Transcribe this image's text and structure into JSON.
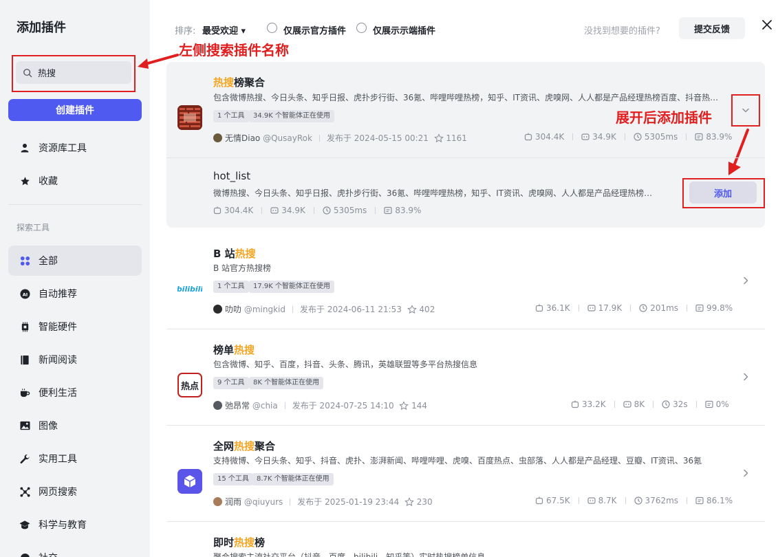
{
  "sidebar": {
    "title": "添加插件",
    "search_value": "热搜",
    "create_label": "创建插件",
    "top_items": [
      {
        "label": "资源库工具",
        "icon": "person-icon"
      },
      {
        "label": "收藏",
        "icon": "star-icon"
      }
    ],
    "section_label": "探索工具",
    "items": [
      {
        "label": "全部",
        "icon": "grid-icon"
      },
      {
        "label": "自动推荐",
        "icon": "ai-icon"
      },
      {
        "label": "智能硬件",
        "icon": "chip-icon"
      },
      {
        "label": "新闻阅读",
        "icon": "book-icon"
      },
      {
        "label": "便利生活",
        "icon": "cup-icon"
      },
      {
        "label": "图像",
        "icon": "image-icon"
      },
      {
        "label": "实用工具",
        "icon": "wrench-icon"
      },
      {
        "label": "网页搜索",
        "icon": "network-icon"
      },
      {
        "label": "科学与教育",
        "icon": "graduation-icon"
      },
      {
        "label": "社交",
        "icon": "chat-icon"
      }
    ]
  },
  "topbar": {
    "sort_label": "排序:",
    "sort_value": "最受欢迎 ▾",
    "official_only": "仅展示官方插件",
    "client_only": "仅展示示端插件",
    "hint": "没找到想要的插件?",
    "feedback": "提交反馈"
  },
  "annotations": {
    "search": "左侧搜索插件名称",
    "add": "展开后添加插件"
  },
  "plugins": [
    {
      "title_pre": "",
      "title_hl": "热搜",
      "title_post": "榜聚合",
      "desc": "包含微博热搜、今日头条、知乎日报、虎扑步行街、36氪、哔哩哔哩热榜，知乎、IT资讯、虎嗅网、人人都是产品经理热榜百度、抖音热…",
      "tag1": "1 个工具",
      "tag2": "34.9K 个智能体正在使用",
      "author": "无情Diao",
      "handle": "@QusayRok",
      "published": "发布于 2024-05-15 00:21",
      "stars": "1161",
      "calls": "304.4K",
      "bots": "34.9K",
      "latency": "5305ms",
      "success": "83.9%"
    },
    {
      "title_pre": "B 站",
      "title_hl": "热搜",
      "title_post": "",
      "desc": "B 站官方热搜榜",
      "tag1": "1 个工具",
      "tag2": "17.9K 个智能体正在使用",
      "author": "叻叻",
      "handle": "@mingkid",
      "published": "发布于 2024-06-11 21:53",
      "stars": "402",
      "calls": "36.1K",
      "bots": "17.9K",
      "latency": "201ms",
      "success": "99.8%"
    },
    {
      "title_pre": "榜单",
      "title_hl": "热搜",
      "title_post": "",
      "desc": "包含微博、知乎、百度，抖音、头条、腾讯，英雄联盟等多平台热搜信息",
      "tag1": "9 个工具",
      "tag2": "8K 个智能体正在使用",
      "author": "弛昂常",
      "handle": "@chia",
      "published": "发布于 2024-07-25 14:10",
      "stars": "144",
      "calls": "33.2K",
      "bots": "8K",
      "latency": "32s",
      "success": "0%"
    },
    {
      "title_pre": "全网",
      "title_hl": "热搜",
      "title_post": "聚合",
      "desc": "支持微博、今日头条、知乎、抖音、虎扑、澎湃新闻、哔哩哔哩、虎嗅、百度热点、虫部落、人人都是产品经理、豆瓣、IT资讯、36氪",
      "tag1": "15 个工具",
      "tag2": "8.7K 个智能体正在使用",
      "author": "润雨",
      "handle": "@qiuyurs",
      "published": "发布于 2025-01-19 23:44",
      "stars": "230",
      "calls": "67.5K",
      "bots": "8.7K",
      "latency": "3762ms",
      "success": "86.1%"
    },
    {
      "title_pre": "即时",
      "title_hl": "热搜",
      "title_post": "榜",
      "desc": "聚合搜索主流社交平台（抖音、百度、bilibili、知乎等）实时热搜榜单信息"
    }
  ],
  "tool": {
    "name": "hot_list",
    "desc": "微博热搜、今日头条、知乎日报、虎扑步行街、36氪、哔哩哔哩热榜，知乎、IT资讯、虎嗅网、人人都是产品经理热榜…",
    "calls": "304.4K",
    "bots": "34.9K",
    "latency": "5305ms",
    "success": "83.9%",
    "add_label": "添加"
  },
  "logos": {
    "bilibili_text": "bilibili",
    "redian_text": "热点"
  }
}
